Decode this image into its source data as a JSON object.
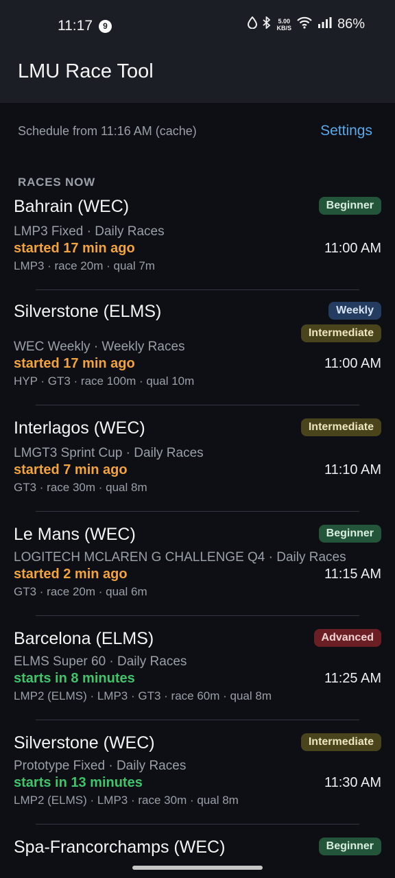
{
  "status_bar": {
    "time": "11:17",
    "notification_count": "9",
    "speed_value": "5.00",
    "speed_unit": "KB/S",
    "battery": "86%"
  },
  "app": {
    "title": "LMU Race Tool"
  },
  "header": {
    "schedule_text": "Schedule from 11:16 AM (cache)",
    "settings_label": "Settings"
  },
  "section_title": "RACES NOW",
  "badge_colors": {
    "beginner": "#23553a",
    "intermediate": "#49441b",
    "weekly": "#243c5f",
    "advanced": "#6a1f24",
    "started": "#f2a33c",
    "upcoming": "#3fc46c",
    "link": "#5aa9e8"
  },
  "races": [
    {
      "name": "Bahrain (WEC)",
      "badges": [
        "Beginner"
      ],
      "subtitle": "LMP3 Fixed · Daily Races",
      "status": "started 17 min ago",
      "status_kind": "started",
      "time": "11:00 AM",
      "meta": "LMP3 · race 20m · qual 7m"
    },
    {
      "name": "Silverstone (ELMS)",
      "badges": [
        "Weekly",
        "Intermediate"
      ],
      "subtitle": "WEC Weekly · Weekly Races",
      "status": "started 17 min ago",
      "status_kind": "started",
      "time": "11:00 AM",
      "meta": "HYP · GT3 · race 100m · qual 10m"
    },
    {
      "name": "Interlagos (WEC)",
      "badges": [
        "Intermediate"
      ],
      "subtitle": "LMGT3 Sprint Cup · Daily Races",
      "status": "started 7 min ago",
      "status_kind": "started",
      "time": "11:10 AM",
      "meta": "GT3 · race 30m · qual 8m"
    },
    {
      "name": "Le Mans (WEC)",
      "badges": [
        "Beginner"
      ],
      "subtitle": "LOGITECH MCLAREN G CHALLENGE Q4 · Daily Races",
      "status": "started 2 min ago",
      "status_kind": "started",
      "time": "11:15 AM",
      "meta": "GT3 · race 20m · qual 6m"
    },
    {
      "name": "Barcelona (ELMS)",
      "badges": [
        "Advanced"
      ],
      "subtitle": "ELMS Super 60 · Daily Races",
      "status": "starts in 8 minutes",
      "status_kind": "upcoming",
      "time": "11:25 AM",
      "meta": "LMP2 (ELMS) · LMP3 · GT3 · race 60m · qual 8m"
    },
    {
      "name": "Silverstone (WEC)",
      "badges": [
        "Intermediate"
      ],
      "subtitle": "Prototype Fixed · Daily Races",
      "status": "starts in 13 minutes",
      "status_kind": "upcoming",
      "time": "11:30 AM",
      "meta": "LMP2 (ELMS) · LMP3 · race 30m · qual 8m"
    },
    {
      "name": "Spa-Francorchamps (WEC)",
      "badges": [
        "Beginner"
      ],
      "subtitle": "",
      "status": "",
      "status_kind": "",
      "time": "",
      "meta": ""
    }
  ]
}
